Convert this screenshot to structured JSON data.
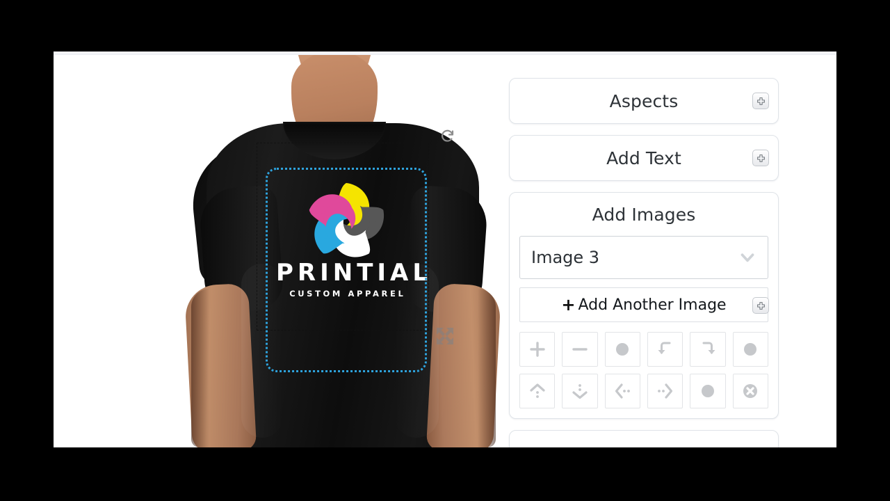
{
  "app": {
    "background_color": "#000000",
    "page_background": "#ffffff"
  },
  "preview": {
    "product": "black t-shirt on male model",
    "shirt_color": "#121212",
    "print_area_label": "print-area",
    "selection_color": "#2ea3dd",
    "handles": {
      "rotate": "rotate-icon",
      "resize": "resize-arrows-icon"
    },
    "artwork": {
      "wordmark": "PRINTIAL",
      "tagline": "CUSTOM APPAREL",
      "text_color": "#ffffff",
      "pinwheel_colors": {
        "yellow": "#f5e400",
        "magenta": "#e0499b",
        "gray": "#575757",
        "white": "#ffffff",
        "cyan": "#29a8df"
      }
    }
  },
  "tools": {
    "panels": [
      {
        "id": "aspects",
        "title": "Aspects",
        "head_icon": "add-panel-icon"
      },
      {
        "id": "add-text",
        "title": "Add Text",
        "head_icon": "add-panel-icon"
      },
      {
        "id": "add-images",
        "title": "Add Images",
        "head_icon": "add-panel-icon"
      }
    ],
    "images": {
      "select": {
        "value": "Image 3",
        "chevron_icon": "chevron-down-icon"
      },
      "add_another": {
        "plus": "+",
        "label": "Add Another Image"
      },
      "buttons": [
        {
          "name": "zoom-in-button",
          "icon": "plus-icon"
        },
        {
          "name": "zoom-out-button",
          "icon": "minus-icon"
        },
        {
          "name": "circle-button-1",
          "icon": "circle-icon"
        },
        {
          "name": "rotate-left-button",
          "icon": "rotate-left-icon"
        },
        {
          "name": "rotate-right-button",
          "icon": "rotate-right-icon"
        },
        {
          "name": "circle-button-2",
          "icon": "circle-icon"
        },
        {
          "name": "move-up-button",
          "icon": "arrow-up-icon"
        },
        {
          "name": "move-down-button",
          "icon": "arrow-down-icon"
        },
        {
          "name": "move-left-button",
          "icon": "arrow-left-icon"
        },
        {
          "name": "move-right-button",
          "icon": "arrow-right-icon"
        },
        {
          "name": "circle-button-3",
          "icon": "circle-icon"
        },
        {
          "name": "delete-button",
          "icon": "close-circle-icon"
        }
      ]
    }
  }
}
